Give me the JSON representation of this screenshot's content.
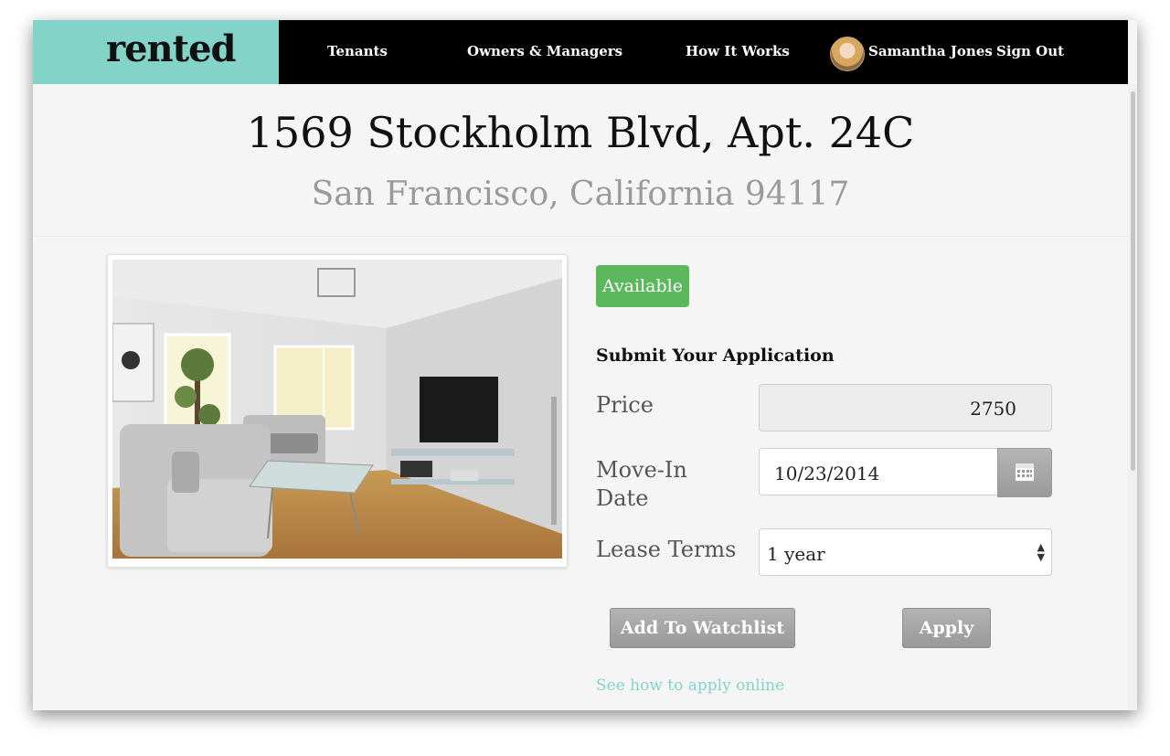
{
  "header": {
    "logo": "rented",
    "nav": [
      "Tenants",
      "Owners & Managers",
      "How It Works"
    ],
    "user_name": "Samantha Jones",
    "sign_out": "Sign Out"
  },
  "listing": {
    "address": "1569 Stockholm Blvd, Apt. 24C",
    "city_line": "San Francisco, California 94117",
    "status": "Available"
  },
  "form": {
    "heading": "Submit Your Application",
    "price_label": "Price",
    "price_value": "2750",
    "move_in_label_1": "Move-In",
    "move_in_label_2": "Date",
    "move_in_value": "10/23/2014",
    "lease_label": "Lease Terms",
    "lease_value": "1 year",
    "watchlist_button": "Add To Watchlist",
    "apply_button": "Apply",
    "help_link": "See how to apply online"
  },
  "colors": {
    "brand": "#84d3c9",
    "header_bg": "#000000",
    "status_green": "#5cb85c",
    "button_gray": "#9e9e9e"
  },
  "icons": [
    "calendar-icon",
    "select-arrows-icon",
    "user-avatar"
  ]
}
